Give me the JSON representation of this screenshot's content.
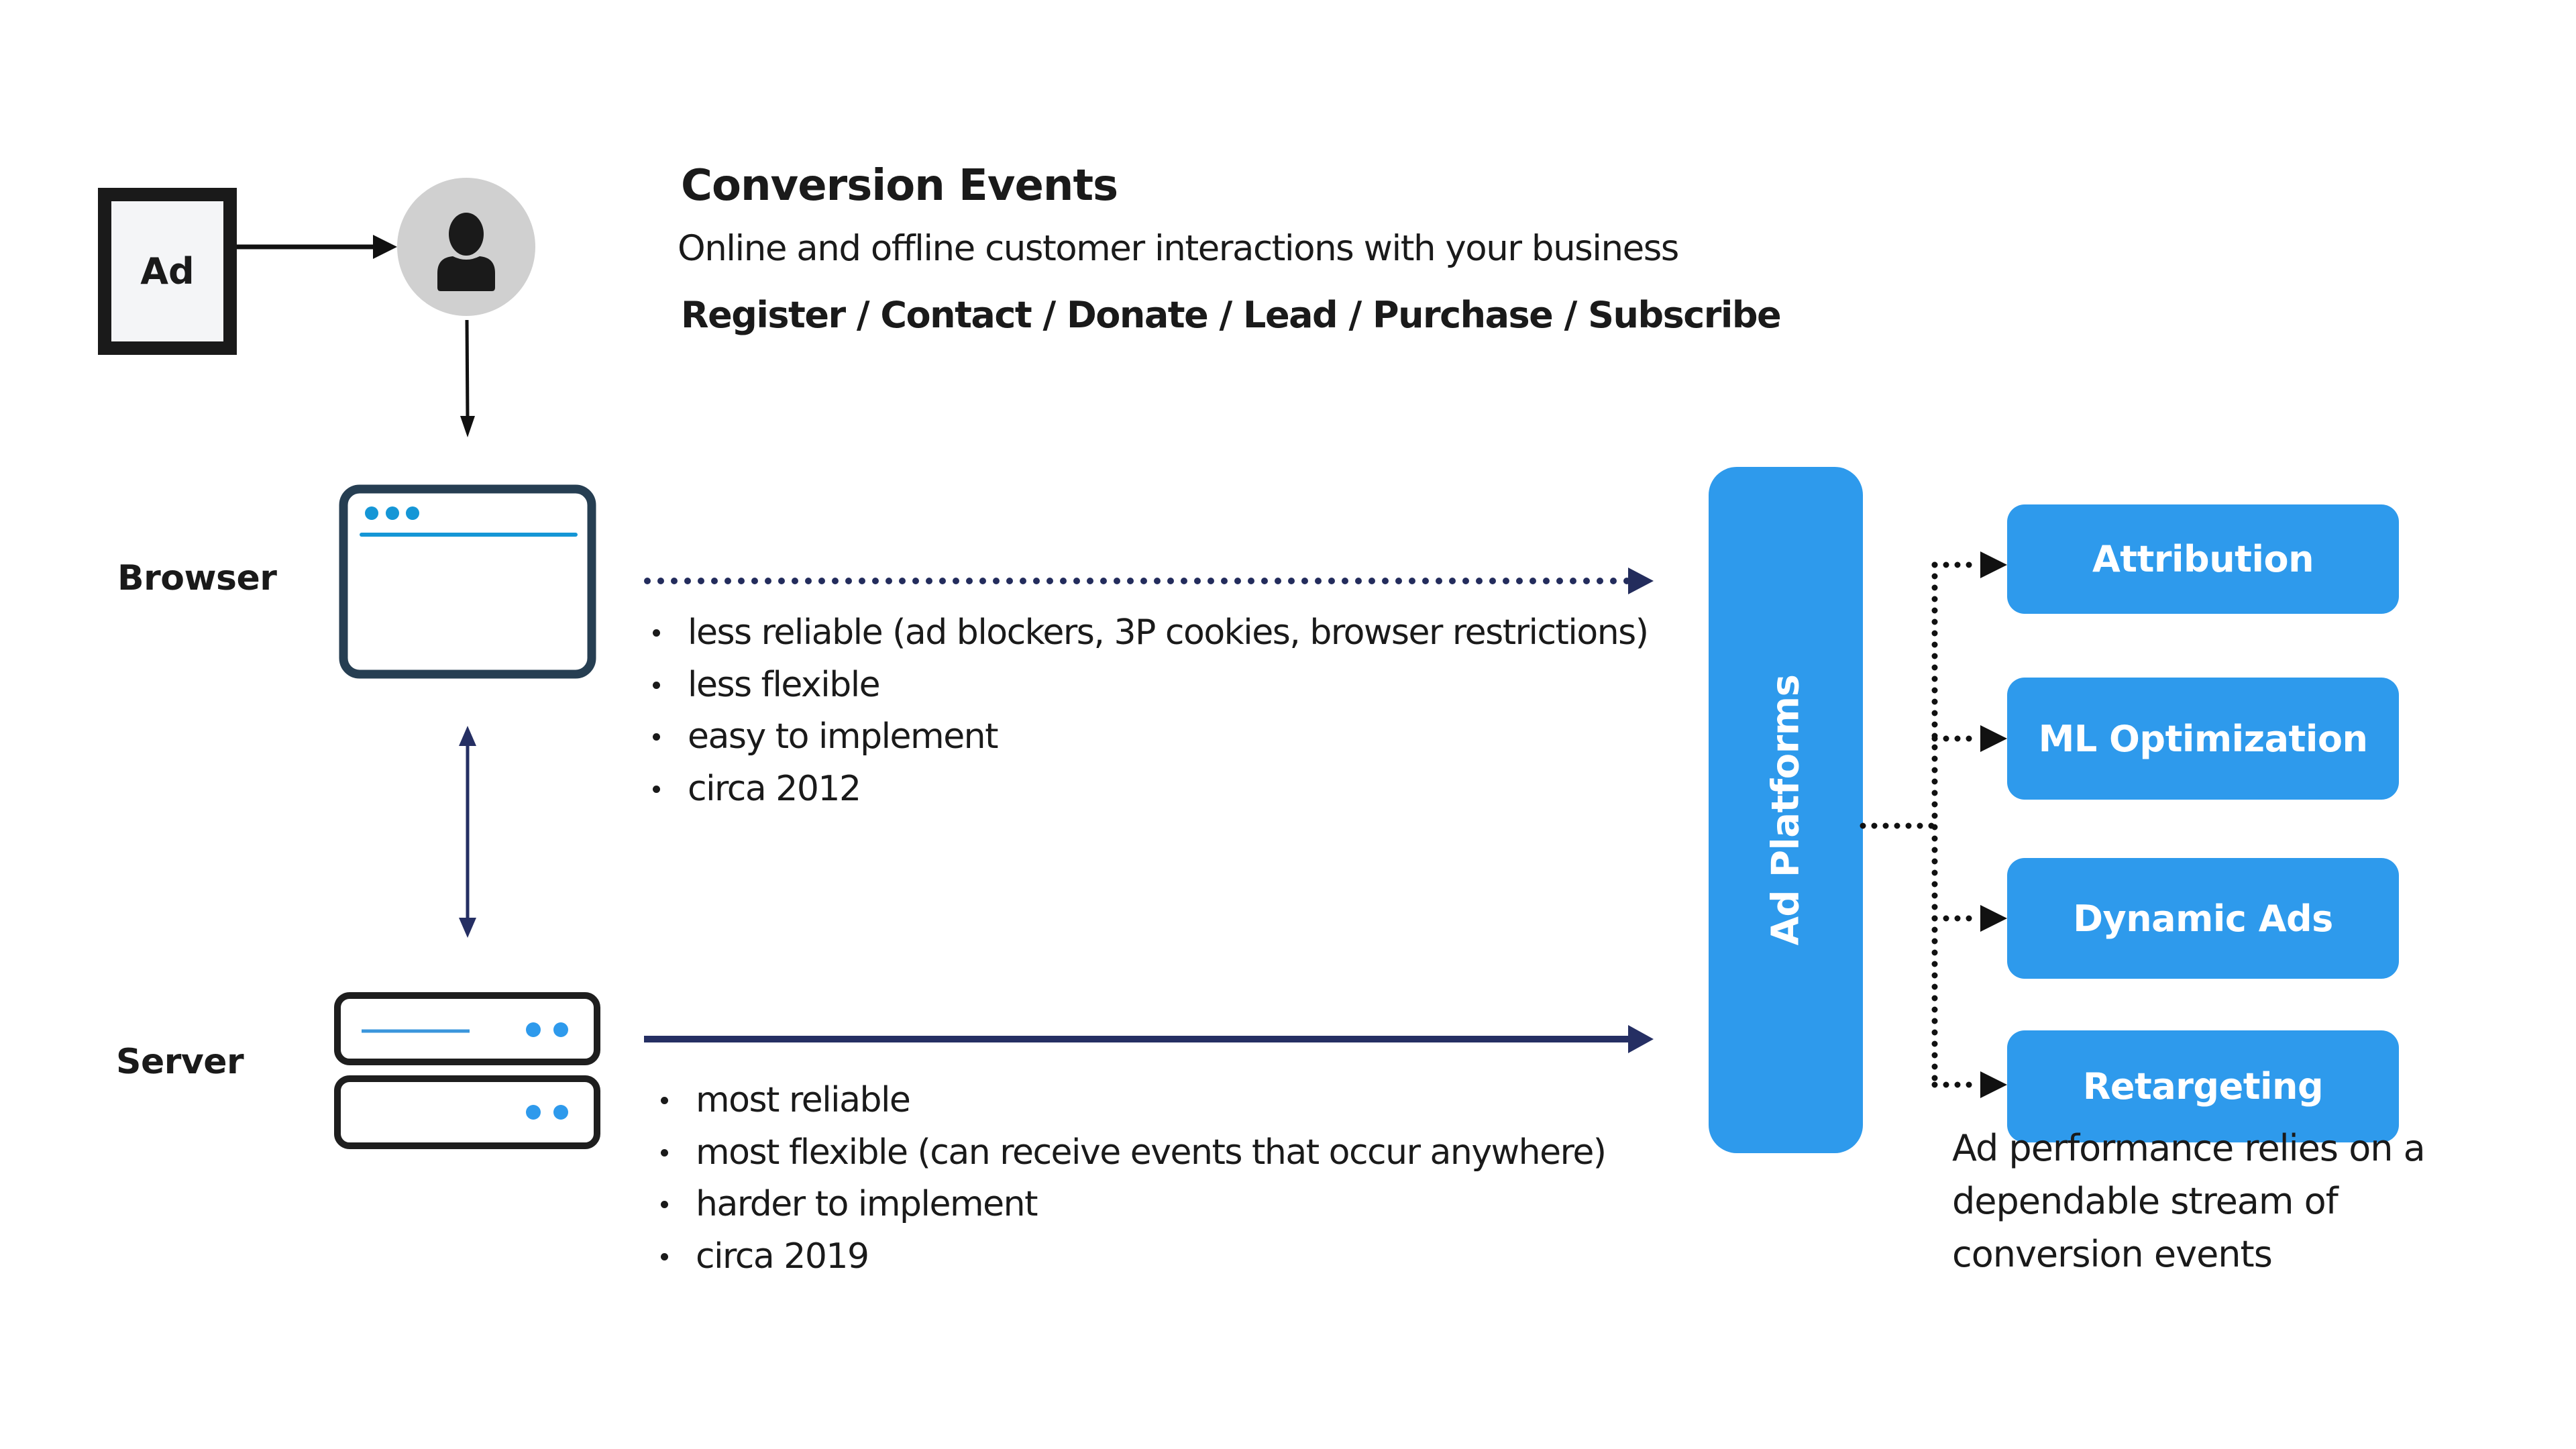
{
  "header": {
    "title": "Conversion Events",
    "subtitle": "Online and offline customer interactions with your business",
    "event_types": "Register / Contact / Donate / Lead / Purchase / Subscribe"
  },
  "nodes": {
    "ad": {
      "label": "Ad",
      "icon": "ad-box"
    },
    "user": {
      "icon": "user-icon"
    },
    "browser": {
      "label": "Browser",
      "icon": "browser-window-icon"
    },
    "server": {
      "label": "Server",
      "icon": "server-rack-icon"
    },
    "ad_platforms": {
      "label": "Ad Platforms"
    }
  },
  "browser_path": {
    "line_style": "dotted",
    "bullets": [
      "less reliable (ad blockers, 3P cookies, browser restrictions)",
      "less flexible",
      "easy to implement",
      "circa 2012"
    ]
  },
  "server_path": {
    "line_style": "solid",
    "bullets": [
      "most reliable",
      "most flexible (can receive events that occur anywhere)",
      "harder to implement",
      "circa 2019"
    ]
  },
  "features": [
    {
      "label": "Attribution"
    },
    {
      "label": "ML Optimization"
    },
    {
      "label": "Dynamic Ads"
    },
    {
      "label": "Retargeting"
    }
  ],
  "footnote": [
    "Ad performance relies on a",
    "dependable stream of",
    "conversion events"
  ],
  "colors": {
    "accent_blue": "#2E9AEC",
    "navy_arrow": "#252F63",
    "browser_frame": "#263E52",
    "browser_accent": "#1596D6",
    "server_frame": "#1E1E1E",
    "server_accent": "#3A96DC",
    "user_circle": "#D0D0D0",
    "ad_box_fill": "#F4F5F7",
    "text": "#1A1A1A"
  }
}
